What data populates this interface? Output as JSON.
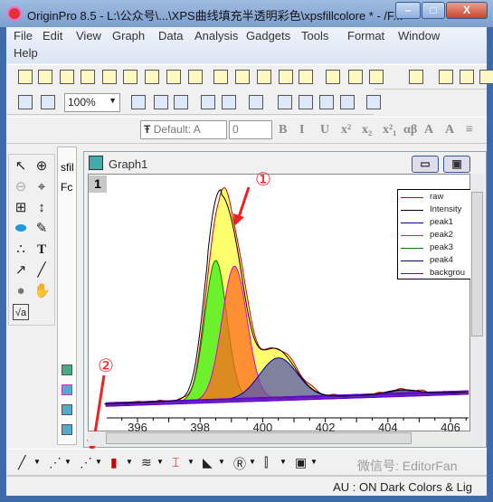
{
  "window": {
    "title": "OriginPro 8.5 - L:\\公众号\\...\\XPS曲线填充半透明彩色\\xpsfillcolore * - /F...",
    "minimize": "–",
    "maximize": "□",
    "close": "X"
  },
  "menu": [
    "File",
    "Edit",
    "View",
    "Graph",
    "Data",
    "Analysis",
    "Gadgets",
    "Tools",
    "Format",
    "Window",
    "Help"
  ],
  "toolbar": {
    "zoom_value": "100%",
    "font_value": "Default: A",
    "size_value": "0",
    "format_buttons": [
      "B",
      "I",
      "U",
      "x²",
      "x₂",
      "x²₁",
      "αβ",
      "A",
      "A",
      "≡"
    ]
  },
  "project_panel": {
    "items": [
      "sfil",
      "Fc"
    ]
  },
  "graph": {
    "title": "Graph1",
    "layer": "1",
    "minimize": "▭",
    "restore": "▣"
  },
  "legend": [
    {
      "label": "raw",
      "color": "#cc0000"
    },
    {
      "label": "Intensity",
      "color": "#000000"
    },
    {
      "label": "peak1",
      "color": "#0000aa"
    },
    {
      "label": "peak2",
      "color": "#dd00dd"
    },
    {
      "label": "peak3",
      "color": "#007700"
    },
    {
      "label": "peak4",
      "color": "#000066"
    },
    {
      "label": "backgrou",
      "color": "#6600cc"
    }
  ],
  "chart_data": {
    "type": "area",
    "x_ticks": [
      "396",
      "398",
      "400",
      "402",
      "404",
      "406"
    ],
    "xlim": [
      395.0,
      406.6
    ],
    "peaks": [
      {
        "name": "peak3",
        "center": 398.5,
        "height": 155,
        "sigma": 0.35,
        "fill": "#55ee22"
      },
      {
        "name": "peak2",
        "center": 399.1,
        "height": 148,
        "sigma": 0.4,
        "fill": "#ff6a20"
      },
      {
        "name": "peak1",
        "center": 400.5,
        "height": 45,
        "sigma": 0.6,
        "fill": "#5555b0"
      },
      {
        "name": "peak4",
        "center": 404.5,
        "height": 5,
        "sigma": 0.5,
        "fill": "#333388"
      }
    ],
    "raw_fill": "#ffff55"
  },
  "annotations": {
    "one": "①",
    "two": "②"
  },
  "status": {
    "text": "AU : ON   Dark Colors & Lig"
  },
  "watermark": "微信号: EditorFan"
}
